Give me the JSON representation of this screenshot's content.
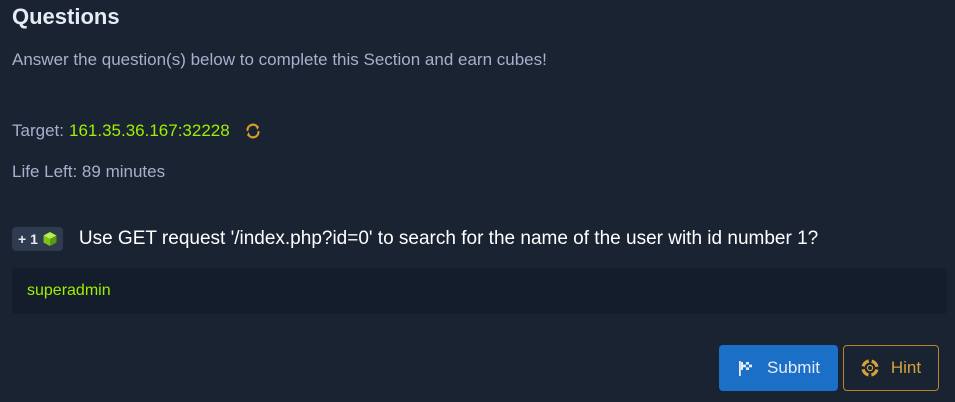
{
  "section": {
    "title": "Questions",
    "subtitle": "Answer the question(s) below to complete this Section and earn cubes!"
  },
  "target": {
    "label": "Target:",
    "value": "161.35.36.167:32228"
  },
  "life": {
    "text": "Life Left: 89 minutes"
  },
  "question": {
    "badge": "+ 1",
    "text": "Use GET request '/index.php?id=0' to search for the name of the user with id number 1?",
    "answer": "superadmin"
  },
  "actions": {
    "submit_label": "Submit",
    "hint_label": "Hint"
  },
  "colors": {
    "background": "#1a2332",
    "accent_green": "#9fef00",
    "submit_blue": "#1b6fc7",
    "hint_gold": "#d4a43a"
  },
  "icons": {
    "refresh": "refresh-icon",
    "cube": "cube-icon",
    "submit": "flag-icon",
    "hint": "lifebuoy-icon"
  }
}
